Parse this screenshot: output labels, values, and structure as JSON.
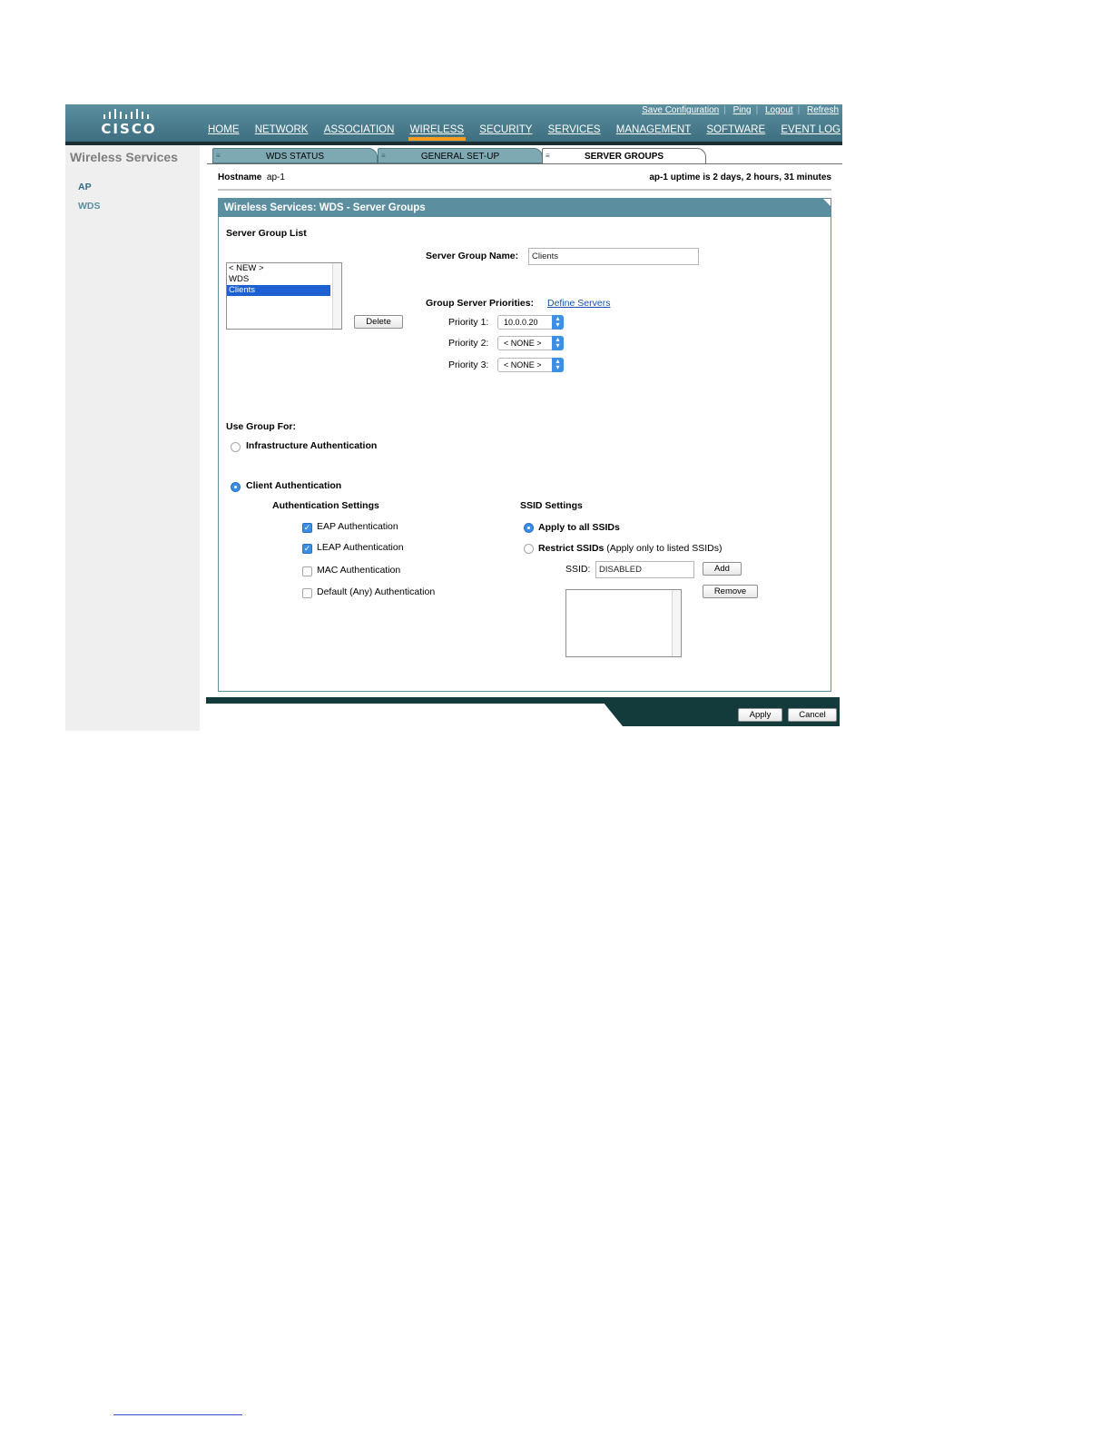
{
  "header": {
    "logo": "CISCO",
    "util_links": [
      "Save Configuration",
      "Ping",
      "Logout",
      "Refresh"
    ],
    "nav": [
      "HOME",
      "NETWORK",
      "ASSOCIATION",
      "WIRELESS",
      "SECURITY",
      "SERVICES",
      "MANAGEMENT",
      "SOFTWARE",
      "EVENT LOG"
    ],
    "active_nav": "WIRELESS",
    "accent_color": "#f39c1e"
  },
  "sidebar": {
    "title": "Wireless Services",
    "items": [
      "AP",
      "WDS"
    ]
  },
  "tabs": [
    "WDS STATUS",
    "GENERAL SET-UP",
    "SERVER GROUPS"
  ],
  "active_tab": "SERVER GROUPS",
  "hostname": {
    "label": "Hostname",
    "value": "ap-1"
  },
  "uptime": "ap-1 uptime is 2 days, 2 hours, 31 minutes",
  "panel": {
    "title": "Wireless Services: WDS - Server Groups",
    "server_group_list_label": "Server Group List",
    "server_group_list": [
      "< NEW >",
      "WDS",
      "Clients"
    ],
    "selected_group": "Clients",
    "delete_button": "Delete",
    "server_group_name_label": "Server Group Name:",
    "server_group_name_value": "Clients",
    "group_priorities_label": "Group Server Priorities:",
    "define_servers_link": "Define Servers",
    "priorities": [
      {
        "label": "Priority 1:",
        "value": "10.0.0.20"
      },
      {
        "label": "Priority 2:",
        "value": "< NONE >"
      },
      {
        "label": "Priority 3:",
        "value": "< NONE >"
      }
    ],
    "use_group_for_label": "Use Group For:",
    "infra_auth_label": "Infrastructure Authentication",
    "client_auth_label": "Client Authentication",
    "selected_use": "Client Authentication",
    "auth_settings_label": "Authentication Settings",
    "auth_options": [
      {
        "label": "EAP Authentication",
        "checked": true
      },
      {
        "label": "LEAP Authentication",
        "checked": true
      },
      {
        "label": "MAC Authentication",
        "checked": false
      },
      {
        "label": "Default (Any) Authentication",
        "checked": false
      }
    ],
    "ssid_settings_label": "SSID Settings",
    "apply_all_ssids_label": "Apply to all SSIDs",
    "restrict_ssids_label": "Restrict SSIDs",
    "restrict_ssids_note": "(Apply only to listed SSIDs)",
    "selected_ssid_mode": "Apply to all SSIDs",
    "ssid_label": "SSID:",
    "ssid_value": "DISABLED",
    "add_button": "Add",
    "remove_button": "Remove"
  },
  "footer": {
    "apply_button": "Apply",
    "cancel_button": "Cancel"
  }
}
